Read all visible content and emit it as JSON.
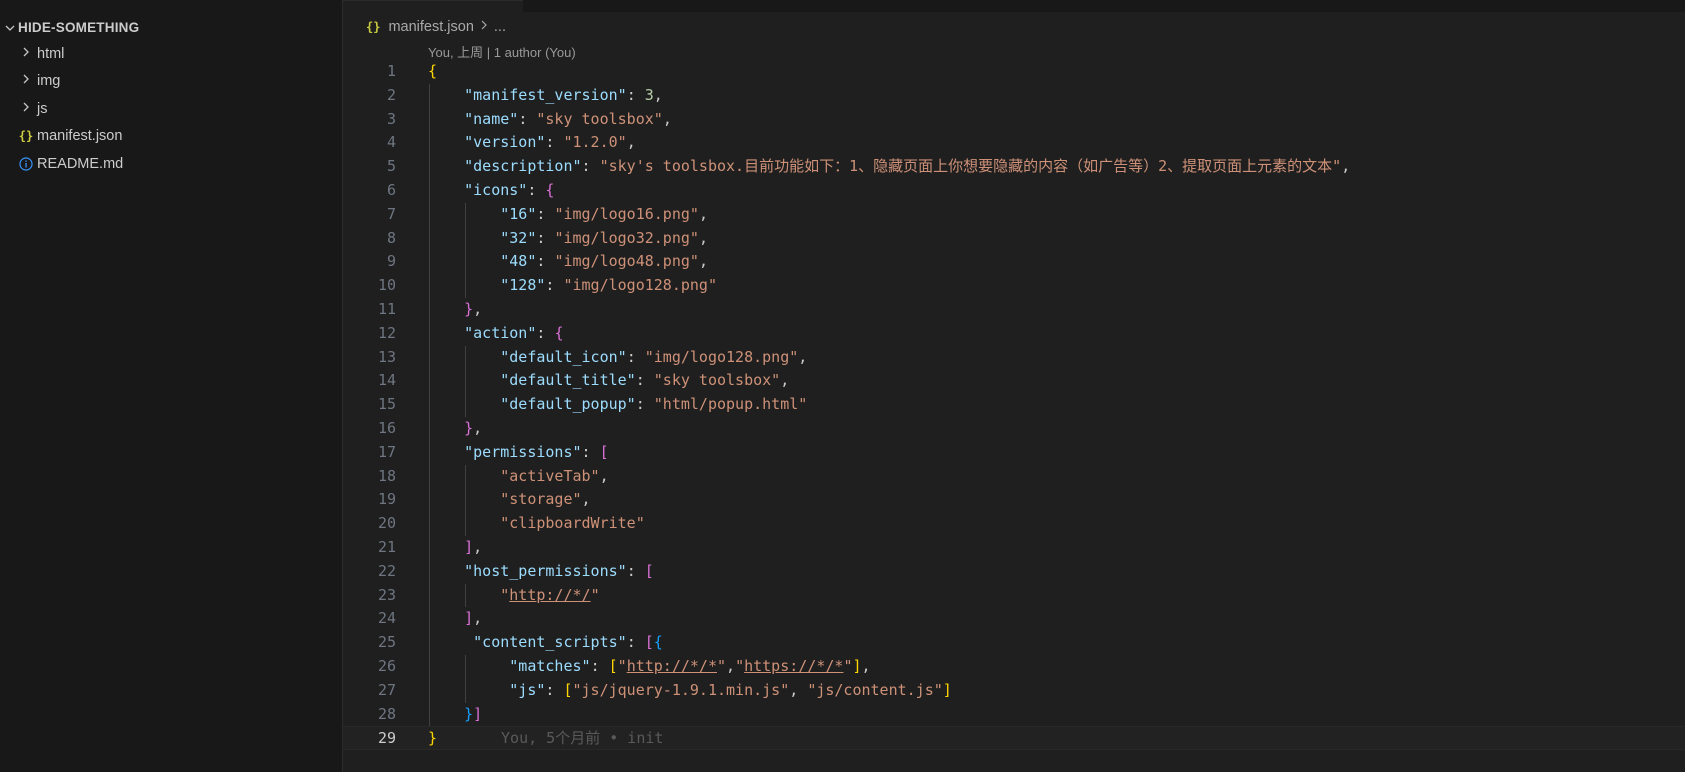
{
  "sidebar": {
    "folder": "HIDE-SOMETHING",
    "items": [
      {
        "type": "folder",
        "label": "html",
        "icon": "chevron-right-icon"
      },
      {
        "type": "folder",
        "label": "img",
        "icon": "chevron-right-icon"
      },
      {
        "type": "folder",
        "label": "js",
        "icon": "chevron-right-icon"
      },
      {
        "type": "file",
        "label": "manifest.json",
        "icon": "json-file-icon",
        "icon_text": "{}"
      },
      {
        "type": "file",
        "label": "README.md",
        "icon": "info-icon"
      }
    ]
  },
  "breadcrumb": {
    "icon_text": "{}",
    "file": "manifest.json",
    "more": "..."
  },
  "codelens": "You, 上周 | 1 author (You)",
  "blame": "You, 5个月前 • init",
  "colors": {
    "key": "#9cdcfe",
    "string": "#ce9178",
    "number": "#b5cea8",
    "bracket_level1": "#ffd700",
    "bracket_level2": "#da70d6",
    "bracket_level3": "#179fff"
  },
  "lines": [
    [
      [
        "b1",
        "{"
      ]
    ],
    [
      [
        "k",
        "    \"manifest_version\""
      ],
      [
        "p",
        ": "
      ],
      [
        "n",
        "3"
      ],
      [
        "p",
        ","
      ]
    ],
    [
      [
        "k",
        "    \"name\""
      ],
      [
        "p",
        ": "
      ],
      [
        "s",
        "\"sky toolsbox\""
      ],
      [
        "p",
        ","
      ]
    ],
    [
      [
        "k",
        "    \"version\""
      ],
      [
        "p",
        ": "
      ],
      [
        "s",
        "\"1.2.0\""
      ],
      [
        "p",
        ","
      ]
    ],
    [
      [
        "k",
        "    \"description\""
      ],
      [
        "p",
        ": "
      ],
      [
        "s",
        "\"sky's toolsbox.目前功能如下：1、隐藏页面上你想要隐藏的内容（如广告等）2、提取页面上元素的文本\""
      ],
      [
        "p",
        ","
      ]
    ],
    [
      [
        "k",
        "    \"icons\""
      ],
      [
        "p",
        ": "
      ],
      [
        "b2",
        "{"
      ]
    ],
    [
      [
        "k",
        "        \"16\""
      ],
      [
        "p",
        ": "
      ],
      [
        "s",
        "\"img/logo16.png\""
      ],
      [
        "p",
        ","
      ]
    ],
    [
      [
        "k",
        "        \"32\""
      ],
      [
        "p",
        ": "
      ],
      [
        "s",
        "\"img/logo32.png\""
      ],
      [
        "p",
        ","
      ]
    ],
    [
      [
        "k",
        "        \"48\""
      ],
      [
        "p",
        ": "
      ],
      [
        "s",
        "\"img/logo48.png\""
      ],
      [
        "p",
        ","
      ]
    ],
    [
      [
        "k",
        "        \"128\""
      ],
      [
        "p",
        ": "
      ],
      [
        "s",
        "\"img/logo128.png\""
      ]
    ],
    [
      [
        "p",
        "    "
      ],
      [
        "b2",
        "}"
      ],
      [
        "p",
        ","
      ]
    ],
    [
      [
        "k",
        "    \"action\""
      ],
      [
        "p",
        ": "
      ],
      [
        "b2",
        "{"
      ]
    ],
    [
      [
        "k",
        "        \"default_icon\""
      ],
      [
        "p",
        ": "
      ],
      [
        "s",
        "\"img/logo128.png\""
      ],
      [
        "p",
        ","
      ]
    ],
    [
      [
        "k",
        "        \"default_title\""
      ],
      [
        "p",
        ": "
      ],
      [
        "s",
        "\"sky toolsbox\""
      ],
      [
        "p",
        ","
      ]
    ],
    [
      [
        "k",
        "        \"default_popup\""
      ],
      [
        "p",
        ": "
      ],
      [
        "s",
        "\"html/popup.html\""
      ]
    ],
    [
      [
        "p",
        "    "
      ],
      [
        "b2",
        "}"
      ],
      [
        "p",
        ","
      ]
    ],
    [
      [
        "k",
        "    \"permissions\""
      ],
      [
        "p",
        ": "
      ],
      [
        "b2",
        "["
      ]
    ],
    [
      [
        "s",
        "        \"activeTab\""
      ],
      [
        "p",
        ","
      ]
    ],
    [
      [
        "s",
        "        \"storage\""
      ],
      [
        "p",
        ","
      ]
    ],
    [
      [
        "s",
        "        \"clipboardWrite\""
      ]
    ],
    [
      [
        "p",
        "    "
      ],
      [
        "b2",
        "]"
      ],
      [
        "p",
        ","
      ]
    ],
    [
      [
        "k",
        "    \"host_permissions\""
      ],
      [
        "p",
        ": "
      ],
      [
        "b2",
        "["
      ]
    ],
    [
      [
        "s",
        "        \""
      ],
      [
        "su",
        "http://*/"
      ],
      [
        "s",
        "\""
      ]
    ],
    [
      [
        "p",
        "    "
      ],
      [
        "b2",
        "]"
      ],
      [
        "p",
        ","
      ]
    ],
    [
      [
        "k",
        "     \"content_scripts\""
      ],
      [
        "p",
        ": "
      ],
      [
        "b2",
        "["
      ],
      [
        "b3",
        "{"
      ]
    ],
    [
      [
        "k",
        "         \"matches\""
      ],
      [
        "p",
        ": "
      ],
      [
        "b1",
        "["
      ],
      [
        "s",
        "\""
      ],
      [
        "su",
        "http://*/*"
      ],
      [
        "s",
        "\""
      ],
      [
        "p",
        ","
      ],
      [
        "s",
        "\""
      ],
      [
        "su",
        "https://*/*"
      ],
      [
        "s",
        "\""
      ],
      [
        "b1",
        "]"
      ],
      [
        "p",
        ","
      ]
    ],
    [
      [
        "k",
        "         \"js\""
      ],
      [
        "p",
        ": "
      ],
      [
        "b1",
        "["
      ],
      [
        "s",
        "\"js/jquery-1.9.1.min.js\""
      ],
      [
        "p",
        ", "
      ],
      [
        "s",
        "\"js/content.js\""
      ],
      [
        "b1",
        "]"
      ]
    ],
    [
      [
        "p",
        "    "
      ],
      [
        "b3",
        "}"
      ],
      [
        "b2",
        "]"
      ]
    ],
    [
      [
        "b1",
        "}"
      ]
    ]
  ]
}
